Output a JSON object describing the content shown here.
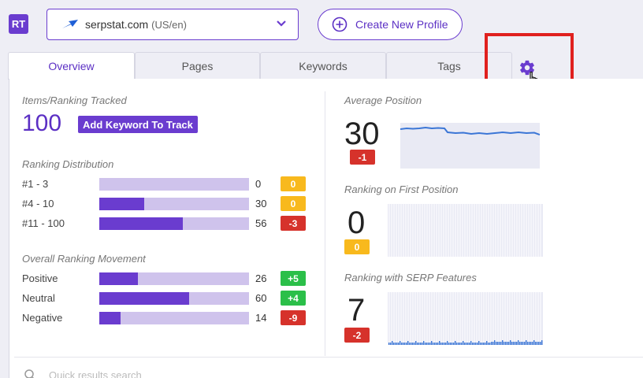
{
  "app": {
    "logo": "RT"
  },
  "profile": {
    "site": "serpstat.com",
    "region": "(US/en)",
    "icon": "serpstat-logo"
  },
  "create_button": "Create New Profile",
  "tabs": [
    {
      "label": "Overview",
      "active": true
    },
    {
      "label": "Pages",
      "active": false
    },
    {
      "label": "Keywords",
      "active": false
    },
    {
      "label": "Tags",
      "active": false
    }
  ],
  "settings_icon": "gear-icon",
  "items_tracked": {
    "label": "Items/Ranking Tracked",
    "value": "100",
    "add_button": "Add Keyword To Track"
  },
  "ranking_distribution": {
    "label": "Ranking Distribution",
    "rows": [
      {
        "label": "#1 - 3",
        "value": "0",
        "fill": 0.0,
        "change": "0",
        "change_color": "yellow"
      },
      {
        "label": "#4 - 10",
        "value": "30",
        "fill": 0.3,
        "change": "0",
        "change_color": "yellow"
      },
      {
        "label": "#11 - 100",
        "value": "56",
        "fill": 0.56,
        "change": "-3",
        "change_color": "red"
      }
    ]
  },
  "ranking_movement": {
    "label": "Overall Ranking Movement",
    "rows": [
      {
        "label": "Positive",
        "value": "26",
        "fill": 0.26,
        "change": "+5",
        "change_color": "green"
      },
      {
        "label": "Neutral",
        "value": "60",
        "fill": 0.6,
        "change": "+4",
        "change_color": "green"
      },
      {
        "label": "Negative",
        "value": "14",
        "fill": 0.14,
        "change": "-9",
        "change_color": "red"
      }
    ]
  },
  "average_position": {
    "label": "Average Position",
    "value": "30",
    "change": "-1"
  },
  "first_position": {
    "label": "Ranking on First Position",
    "value": "0",
    "change": "0"
  },
  "serp_features": {
    "label": "Ranking with SERP Features",
    "value": "7",
    "change": "-2"
  },
  "search": {
    "placeholder": "Quick results search"
  },
  "colors": {
    "accent": "#6a3ccf",
    "bar_track": "#cfc3ec",
    "yellow": "#f8b91d",
    "red": "#d6322b",
    "green": "#2bbf49",
    "highlight": "#e0201e"
  }
}
